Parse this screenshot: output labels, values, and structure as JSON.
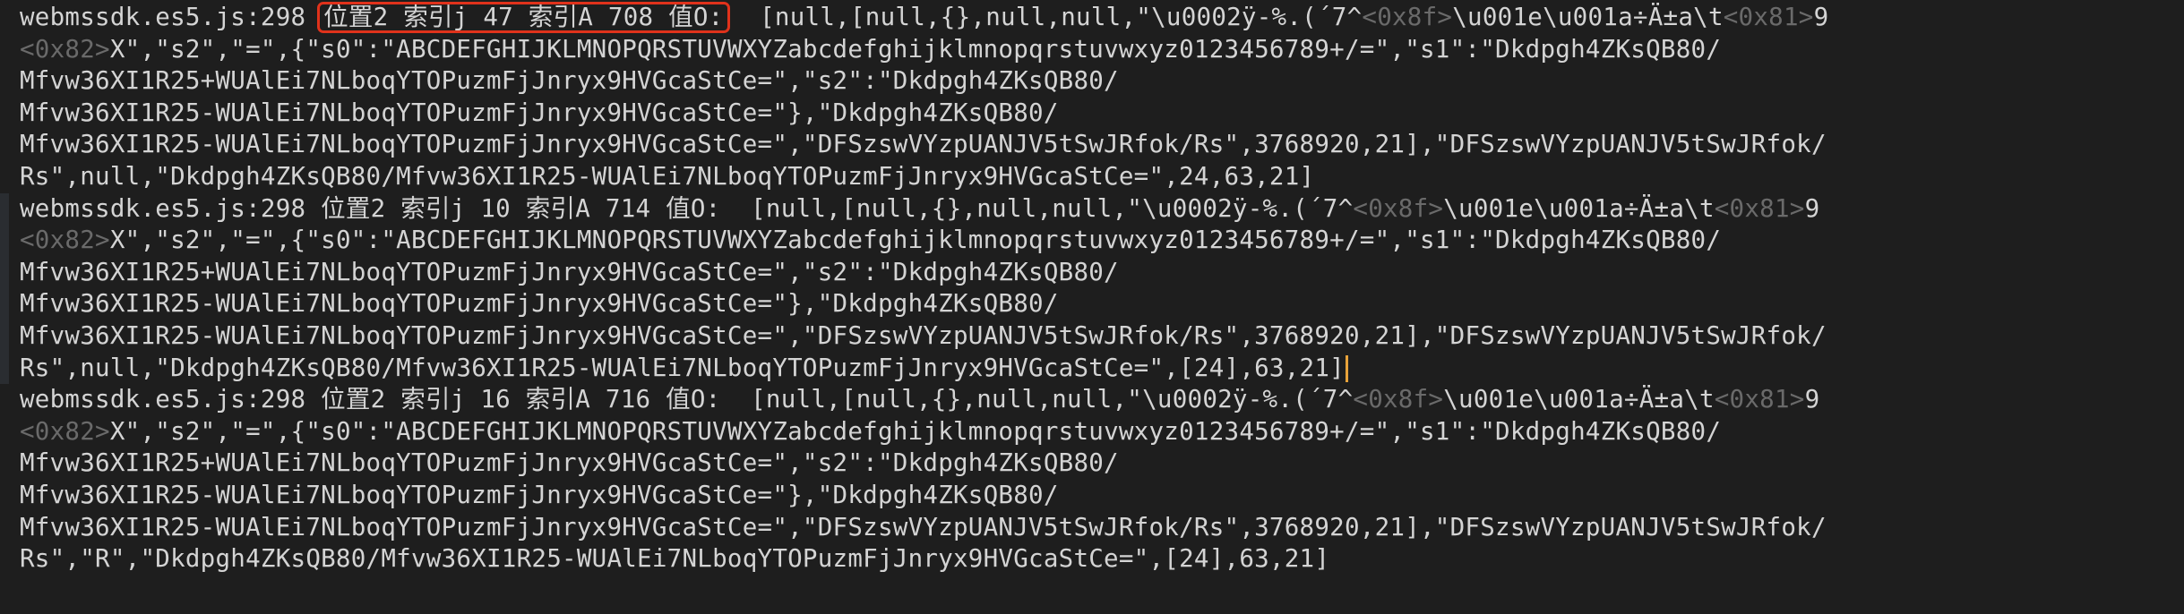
{
  "console": {
    "entries": [
      {
        "source": "webmssdk.es5.js:298",
        "label": "位置2 索引j 47 索引A 708 值O:",
        "highlighted": true,
        "lines": [
          {
            "a": "[null,[null,{},null,null,\"\\u0002ÿ-%.(´7^",
            "b": "<0x8f>",
            "c": "\\u001e\\u001a÷Ä±a\\t",
            "d": "<0x81>",
            "e": "9"
          },
          {
            "a": "",
            "b": "<0x82>",
            "c": "X\",\"s2\",\"=\",{\"s0\":\"ABCDEFGHIJKLMNOPQRSTUVWXYZabcdefghijklmnopqrstuvwxyz0123456789+/=\",\"s1\":\"Dkdpgh4ZKsQB80/",
            "d": "",
            "e": ""
          },
          {
            "a": "Mfvw36XI1R25+WUAlEi7NLboqYTOPuzmFjJnryx9HVGcaStCe=\",\"s2\":\"Dkdpgh4ZKsQB80/",
            "b": "",
            "c": "",
            "d": "",
            "e": ""
          },
          {
            "a": "Mfvw36XI1R25-WUAlEi7NLboqYTOPuzmFjJnryx9HVGcaStCe=\"},\"Dkdpgh4ZKsQB80/",
            "b": "",
            "c": "",
            "d": "",
            "e": ""
          },
          {
            "a": "Mfvw36XI1R25-WUAlEi7NLboqYTOPuzmFjJnryx9HVGcaStCe=\",\"DFSzswVYzpUANJV5tSwJRfok/Rs\",3768920,21],\"DFSzswVYzpUANJV5tSwJRfok/",
            "b": "",
            "c": "",
            "d": "",
            "e": ""
          },
          {
            "a": "Rs\",null,\"Dkdpgh4ZKsQB80/Mfvw36XI1R25-WUAlEi7NLboqYTOPuzmFjJnryx9HVGcaStCe=\",24,63,21]",
            "b": "",
            "c": "",
            "d": "",
            "e": ""
          }
        ]
      },
      {
        "source": "webmssdk.es5.js:298",
        "label": "位置2 索引j 10 索引A 714 值O:",
        "highlighted": false,
        "lines": [
          {
            "a": "[null,[null,{},null,null,\"\\u0002ÿ-%.(´7^",
            "b": "<0x8f>",
            "c": "\\u001e\\u001a÷Ä±a\\t",
            "d": "<0x81>",
            "e": "9"
          },
          {
            "a": "",
            "b": "<0x82>",
            "c": "X\",\"s2\",\"=\",{\"s0\":\"ABCDEFGHIJKLMNOPQRSTUVWXYZabcdefghijklmnopqrstuvwxyz0123456789+/=\",\"s1\":\"Dkdpgh4ZKsQB80/",
            "d": "",
            "e": ""
          },
          {
            "a": "Mfvw36XI1R25+WUAlEi7NLboqYTOPuzmFjJnryx9HVGcaStCe=\",\"s2\":\"Dkdpgh4ZKsQB80/",
            "b": "",
            "c": "",
            "d": "",
            "e": ""
          },
          {
            "a": "Mfvw36XI1R25-WUAlEi7NLboqYTOPuzmFjJnryx9HVGcaStCe=\"},\"Dkdpgh4ZKsQB80/",
            "b": "",
            "c": "",
            "d": "",
            "e": ""
          },
          {
            "a": "Mfvw36XI1R25-WUAlEi7NLboqYTOPuzmFjJnryx9HVGcaStCe=\",\"DFSzswVYzpUANJV5tSwJRfok/Rs\",3768920,21],\"DFSzswVYzpUANJV5tSwJRfok/",
            "b": "",
            "c": "",
            "d": "",
            "e": ""
          },
          {
            "a": "Rs\",null,\"Dkdpgh4ZKsQB80/Mfvw36XI1R25-WUAlEi7NLboqYTOPuzmFjJnryx9HVGcaStCe=\",[24],63,21]",
            "b": "",
            "c": "",
            "d": "",
            "e": "",
            "caret": true
          }
        ]
      },
      {
        "source": "webmssdk.es5.js:298",
        "label": "位置2 索引j 16 索引A 716 值O:",
        "highlighted": false,
        "lines": [
          {
            "a": "[null,[null,{},null,null,\"\\u0002ÿ-%.(´7^",
            "b": "<0x8f>",
            "c": "\\u001e\\u001a÷Ä±a\\t",
            "d": "<0x81>",
            "e": "9"
          },
          {
            "a": "",
            "b": "<0x82>",
            "c": "X\",\"s2\",\"=\",{\"s0\":\"ABCDEFGHIJKLMNOPQRSTUVWXYZabcdefghijklmnopqrstuvwxyz0123456789+/=\",\"s1\":\"Dkdpgh4ZKsQB80/",
            "d": "",
            "e": ""
          },
          {
            "a": "Mfvw36XI1R25+WUAlEi7NLboqYTOPuzmFjJnryx9HVGcaStCe=\",\"s2\":\"Dkdpgh4ZKsQB80/",
            "b": "",
            "c": "",
            "d": "",
            "e": ""
          },
          {
            "a": "Mfvw36XI1R25-WUAlEi7NLboqYTOPuzmFjJnryx9HVGcaStCe=\"},\"Dkdpgh4ZKsQB80/",
            "b": "",
            "c": "",
            "d": "",
            "e": ""
          },
          {
            "a": "Mfvw36XI1R25-WUAlEi7NLboqYTOPuzmFjJnryx9HVGcaStCe=\",\"DFSzswVYzpUANJV5tSwJRfok/Rs\",3768920,21],\"DFSzswVYzpUANJV5tSwJRfok/",
            "b": "",
            "c": "",
            "d": "",
            "e": ""
          },
          {
            "a": "Rs\",\"R\",\"Dkdpgh4ZKsQB80/Mfvw36XI1R25-WUAlEi7NLboqYTOPuzmFjJnryx9HVGcaStCe=\",[24],63,21]",
            "b": "",
            "c": "",
            "d": "",
            "e": ""
          }
        ]
      }
    ]
  },
  "colors": {
    "background": "#1e1e1e",
    "text": "#d4d4d4",
    "control_char": "#6a6a6a",
    "highlight_box": "#e0321b",
    "caret": "#e8a33a"
  }
}
